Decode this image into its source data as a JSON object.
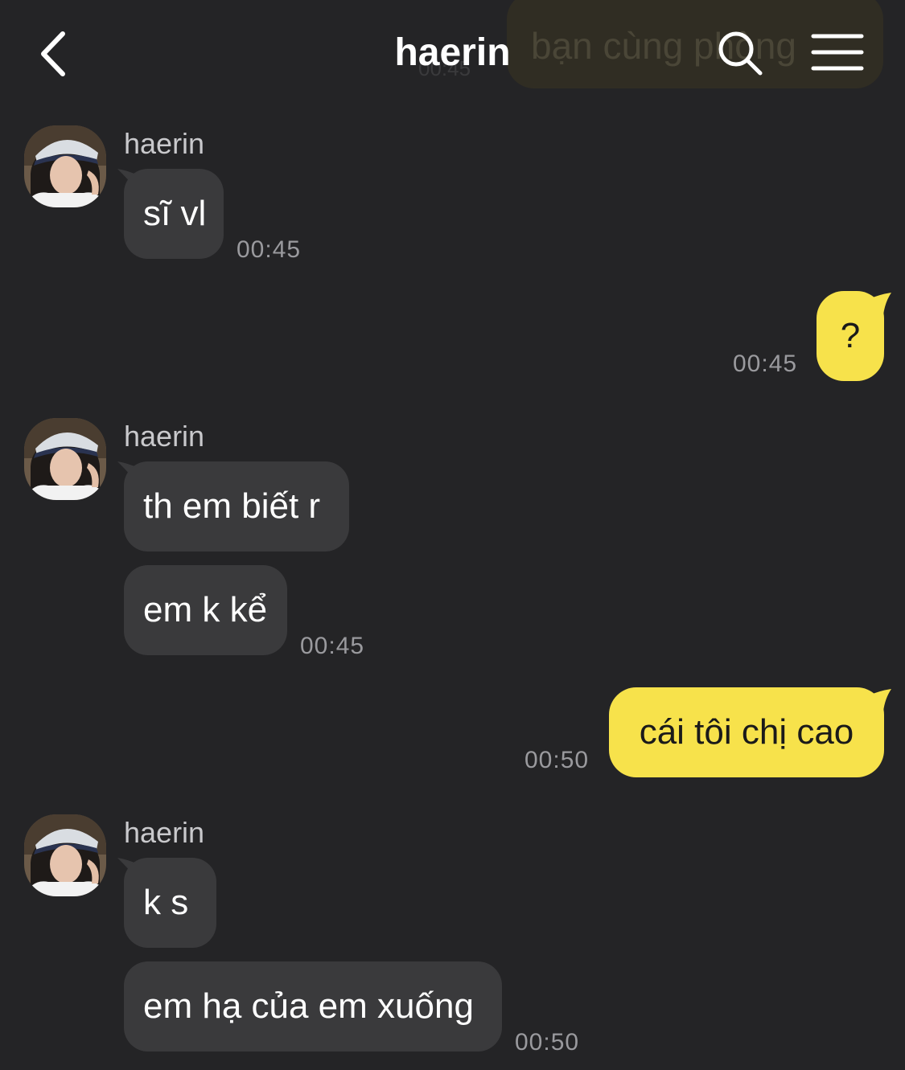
{
  "header": {
    "title": "haerin",
    "pinned_preview": "bạn cùng phòng",
    "pinned_time": "00:45",
    "back_icon": "chevron-left-icon",
    "search_icon": "search-icon",
    "menu_icon": "hamburger-menu-icon"
  },
  "colors": {
    "background": "#242426",
    "incoming_bubble": "#3a3a3c",
    "outgoing_bubble": "#f7e24b",
    "timestamp": "#9a9a9e"
  },
  "messages": {
    "group1": {
      "sender": "haerin",
      "msg1": "sĩ vl",
      "time": "00:45"
    },
    "out1": {
      "text": "?",
      "time": "00:45"
    },
    "group2": {
      "sender": "haerin",
      "msg1": "th em biết r",
      "msg2": "em k kể",
      "time": "00:45"
    },
    "out2": {
      "text": "cái tôi chị cao",
      "time": "00:50"
    },
    "group3": {
      "sender": "haerin",
      "msg1": "k s",
      "msg2": "em hạ của em xuống",
      "time": "00:50"
    }
  }
}
